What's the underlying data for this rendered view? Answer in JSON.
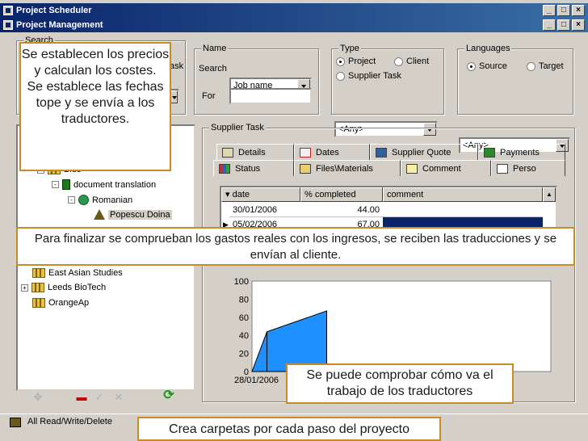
{
  "app": {
    "outer_title": "Project Scheduler",
    "inner_title": "Project Management",
    "min": "_",
    "max": "□",
    "close": "×"
  },
  "search": {
    "group_label": "Search",
    "search_type_partial": "ask",
    "name_group": "Name",
    "search_label": "Search",
    "search_combo": "Job name",
    "for_label": "For",
    "for_value": "",
    "type_group": "Type",
    "type_project": "Project",
    "type_client": "Client",
    "type_supplier_task": "Supplier Task",
    "type_combo": "<Any>",
    "lang_group": "Languages",
    "lang_source": "Source",
    "lang_target": "Target",
    "lang_combo": "<Any>"
  },
  "tree": {
    "items": [
      {
        "label": "Bids"
      },
      {
        "label": "document translation"
      },
      {
        "label": "Romanian"
      },
      {
        "label": "Popescu Doina"
      },
      {
        "label": "East Asian Studies"
      },
      {
        "label": "Leeds BioTech"
      },
      {
        "label": "OrangeAp"
      }
    ]
  },
  "supplier_task": {
    "group_label": "Supplier Task",
    "tabs_row1": [
      "Details",
      "Dates",
      "Supplier Quote",
      "Payments"
    ],
    "tabs_row2": [
      "Status",
      "Files\\Materials",
      "Comment",
      "Perso"
    ],
    "grid": {
      "headers": [
        "date",
        "% completed",
        "comment"
      ],
      "rows": [
        {
          "date": "30/01/2006",
          "pct": "44.00",
          "comment": ""
        },
        {
          "date": "05/02/2006",
          "pct": "67.00",
          "comment": ""
        }
      ]
    }
  },
  "chart_data": {
    "type": "area",
    "x": [
      "28/01/2006",
      "30/01/2006",
      "05/02/2006"
    ],
    "values": [
      0,
      44,
      67
    ],
    "x_tick_label": "28/01/2006",
    "yticks": [
      "100",
      "80",
      "60",
      "40",
      "20",
      "0"
    ],
    "ylim": [
      0,
      100
    ],
    "title": "",
    "xlabel": "",
    "ylabel": "",
    "grid": false,
    "colors": {
      "fill": "#1e90ff",
      "stroke": "#000000"
    }
  },
  "callouts": {
    "top_left": "Se establecen los precios y calculan los costes.\nSe establece las fechas tope y se envía a los traductores.",
    "middle": "Para finalizar se comprueban los gastos reales con los ingresos, se reciben las traducciones y se envían al cliente.",
    "bottom_right": "Se puede comprobar cómo va el trabajo de los traductores",
    "bottom_center": "Crea carpetas por cada paso del proyecto"
  },
  "status": {
    "permissions": "All Read/Write/Delete"
  },
  "colors": {
    "title_bar": "#0a246a",
    "chart_fill": "#1e90ff",
    "selected_row": "#0a246a",
    "callout_border": "#c98a2a"
  }
}
